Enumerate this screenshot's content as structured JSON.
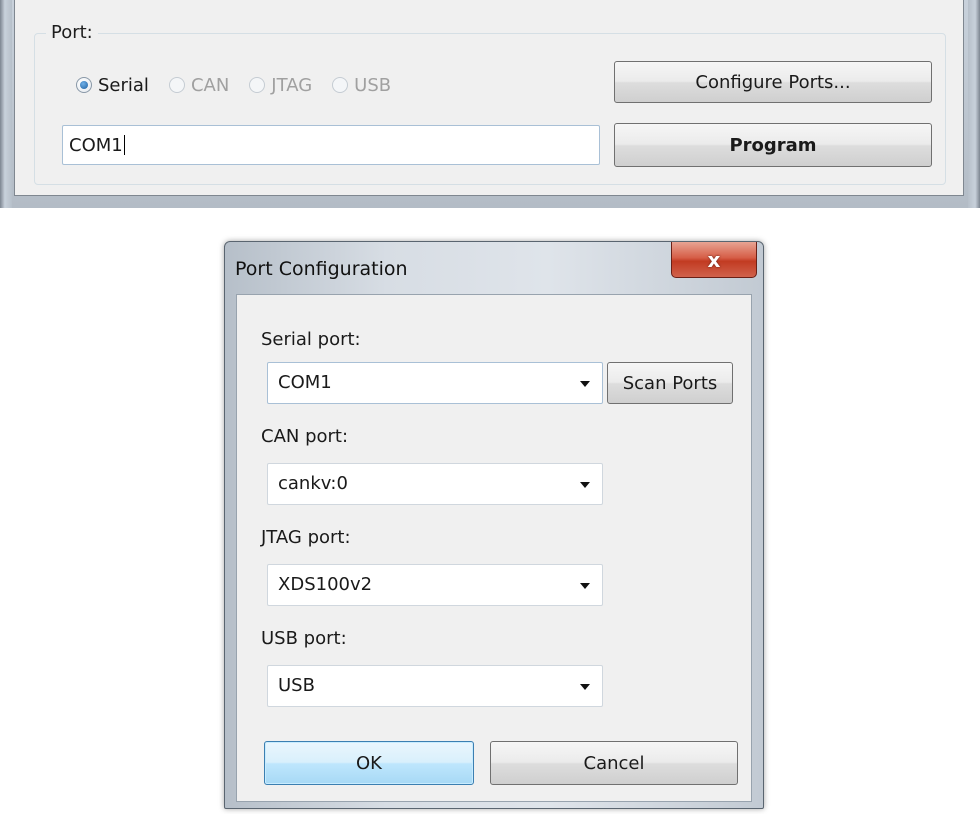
{
  "main": {
    "port_group_label": "Port:",
    "radios": [
      {
        "label": "Serial",
        "selected": true,
        "enabled": true
      },
      {
        "label": "CAN",
        "selected": false,
        "enabled": false
      },
      {
        "label": "JTAG",
        "selected": false,
        "enabled": false
      },
      {
        "label": "USB",
        "selected": false,
        "enabled": false
      }
    ],
    "port_input_value": "COM1",
    "configure_button": "Configure Ports...",
    "program_button": "Program"
  },
  "dialog": {
    "title": "Port Configuration",
    "close_glyph": "x",
    "serial_label": "Serial port:",
    "serial_value": "COM1",
    "scan_button": "Scan Ports",
    "can_label": "CAN port:",
    "can_value": "cankv:0",
    "jtag_label": "JTAG port:",
    "jtag_value": "XDS100v2",
    "usb_label": "USB port:",
    "usb_value": "USB",
    "ok_button": "OK",
    "cancel_button": "Cancel"
  },
  "colors": {
    "accent": "#3c7fb1",
    "close_button": "#c23b22",
    "panel_background": "#f0f0f0"
  },
  "icons": {
    "close": "close-icon",
    "dropdown": "chevron-down-icon"
  }
}
